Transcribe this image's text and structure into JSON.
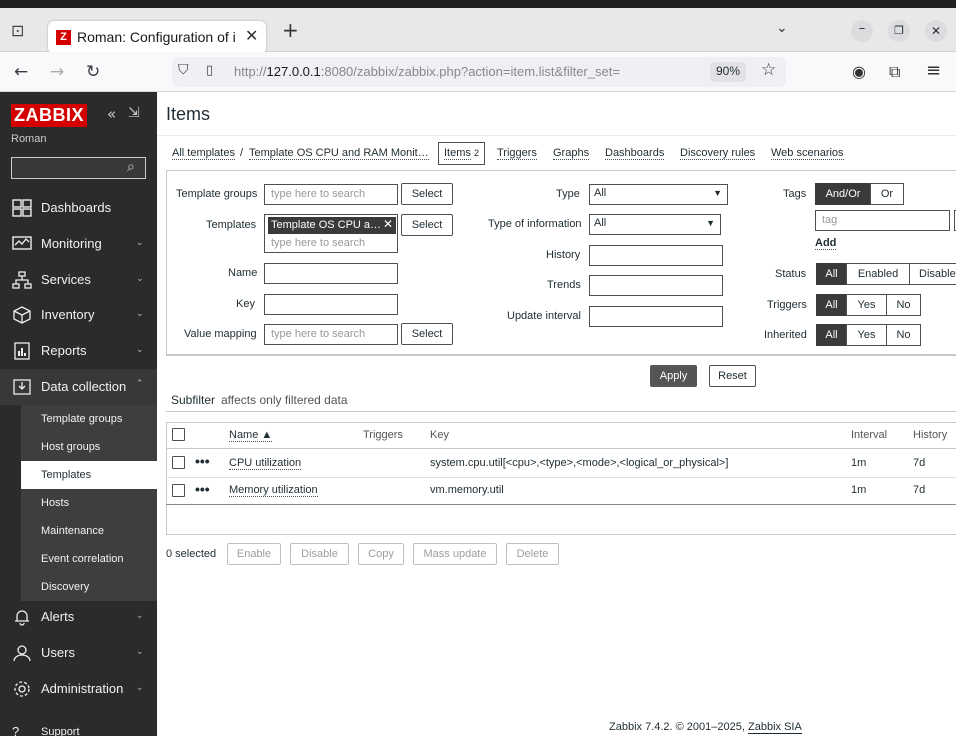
{
  "browser": {
    "tab_title": "Roman: Configuration of i",
    "url_prefix": "http://",
    "url_host": "127.0.0.1",
    "url_rest": ":8080/zabbix/zabbix.php?action=item.list&filter_set=",
    "zoom": "90%"
  },
  "sidebar": {
    "logo": "ZABBIX",
    "user": "Roman",
    "search_placeholder": "",
    "menu": [
      {
        "label": "Dashboards",
        "icon": "dashboards-icon"
      },
      {
        "label": "Monitoring",
        "icon": "monitoring-icon"
      },
      {
        "label": "Services",
        "icon": "services-icon"
      },
      {
        "label": "Inventory",
        "icon": "inventory-icon"
      },
      {
        "label": "Reports",
        "icon": "reports-icon"
      },
      {
        "label": "Data collection",
        "icon": "data-collection-icon"
      },
      {
        "label": "Alerts",
        "icon": "alerts-icon"
      },
      {
        "label": "Users",
        "icon": "users-icon"
      },
      {
        "label": "Administration",
        "icon": "administration-icon"
      },
      {
        "label": "Support",
        "icon": "support-icon"
      }
    ],
    "submenu": [
      "Template groups",
      "Host groups",
      "Templates",
      "Hosts",
      "Maintenance",
      "Event correlation",
      "Discovery"
    ],
    "active_submenu": "Templates"
  },
  "page": {
    "title": "Items",
    "breadcrumbs": {
      "all_templates": "All templates",
      "template": "Template OS CPU and RAM Monit…",
      "items": "Items",
      "items_count": "2",
      "triggers": "Triggers",
      "graphs": "Graphs",
      "dashboards": "Dashboards",
      "discovery_rules": "Discovery rules",
      "web_scenarios": "Web scenarios"
    }
  },
  "filter": {
    "template_groups_label": "Template groups",
    "templates_label": "Templates",
    "name_label": "Name",
    "key_label": "Key",
    "value_mapping_label": "Value mapping",
    "search_placeholder": "type here to search",
    "select_label": "Select",
    "template_chip": "Template OS CPU a…",
    "type_label": "Type",
    "type_value": "All",
    "type_info_label": "Type of information",
    "type_info_value": "All",
    "history_label": "History",
    "trends_label": "Trends",
    "update_interval_label": "Update interval",
    "tags_label": "Tags",
    "tags_andor": "And/Or",
    "tags_or": "Or",
    "tag_placeholder": "tag",
    "add_label": "Add",
    "status_label": "Status",
    "status_all": "All",
    "status_enabled": "Enabled",
    "status_disabled": "Disabled",
    "triggers_label": "Triggers",
    "inherited_label": "Inherited",
    "all": "All",
    "yes": "Yes",
    "no": "No",
    "apply": "Apply",
    "reset": "Reset"
  },
  "subfilter": {
    "title": "Subfilter",
    "text": "affects only filtered data"
  },
  "table": {
    "headers": {
      "name": "Name ▲",
      "triggers": "Triggers",
      "key": "Key",
      "interval": "Interval",
      "history": "History"
    },
    "rows": [
      {
        "name": "CPU utilization",
        "triggers": "",
        "key": "system.cpu.util[<cpu>,<type>,<mode>,<logical_or_physical>]",
        "interval": "1m",
        "history": "7d"
      },
      {
        "name": "Memory utilization",
        "triggers": "",
        "key": "vm.memory.util",
        "interval": "1m",
        "history": "7d"
      }
    ]
  },
  "footer_actions": {
    "selected": "0 selected",
    "enable": "Enable",
    "disable": "Disable",
    "copy": "Copy",
    "mass_update": "Mass update",
    "delete": "Delete"
  },
  "footer": {
    "text": "Zabbix 7.4.2. © 2001–2025,",
    "company": "Zabbix SIA"
  }
}
